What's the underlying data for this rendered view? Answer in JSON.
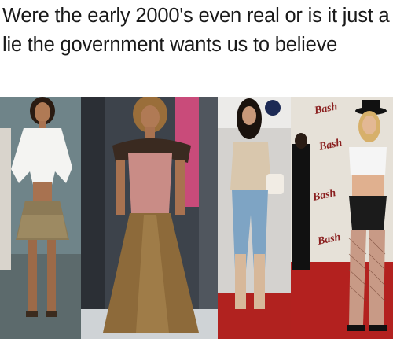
{
  "meme": {
    "caption": "Were the early 2000's even real or is it just a lie the government wants us to believe"
  },
  "photos": [
    {
      "name": "photo-1",
      "bg": "#7a8f94"
    },
    {
      "name": "photo-2",
      "bg": "#3a3f46"
    },
    {
      "name": "photo-3",
      "bg": "#c8c6c4"
    },
    {
      "name": "photo-4",
      "bg": "#e8e4de"
    }
  ],
  "backdrop": {
    "bash_words": [
      "Bash",
      "Bash",
      "Bash",
      "Bash"
    ]
  }
}
